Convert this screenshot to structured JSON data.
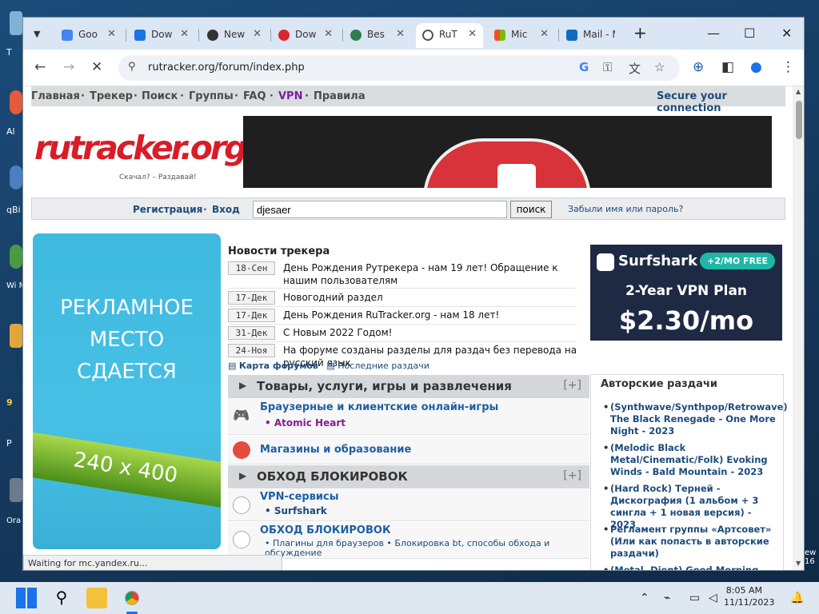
{
  "desktop": {
    "icons": [
      "T",
      "Al",
      "qBi",
      "Wi\nMed",
      "9",
      "P",
      "Ora\nVir",
      "ew\n16"
    ]
  },
  "browser": {
    "tabs": [
      {
        "title": "Goo",
        "icon": "google-icon",
        "color": "#4285f4"
      },
      {
        "title": "Dow",
        "icon": "download-icon",
        "color": "#1a73e8"
      },
      {
        "title": "New",
        "icon": "chrome-icon",
        "color": "#333333"
      },
      {
        "title": "Dow",
        "icon": "mega-icon",
        "color": "#d9272e"
      },
      {
        "title": "Bes",
        "icon": "app-icon",
        "color": "#2e7d4f"
      },
      {
        "title": "RuT",
        "icon": "loading-icon",
        "color": "#555555",
        "active": true
      },
      {
        "title": "Mic",
        "icon": "microsoft-icon",
        "color": "#f25022"
      },
      {
        "title": "Mail - M",
        "icon": "outlook-icon",
        "color": "#0f6cbd"
      }
    ],
    "url": "rutracker.org/forum/index.php",
    "status": "Waiting for mc.yandex.ru..."
  },
  "site": {
    "nav": [
      "Главная",
      "Трекер",
      "Поиск",
      "Группы",
      "FAQ",
      "VPN",
      "Правила"
    ],
    "nav_sep": "·",
    "secure": "Secure your connection",
    "logo": "rutracker",
    "logo_org": ".org",
    "tagline": "Скачал? – Раздавай!",
    "register": "Регистрация",
    "login": "Вход",
    "search_value": "djesaer",
    "search_button": "поиск",
    "forgot": "Забыли имя или пароль?",
    "ad_left": {
      "lines": [
        "РЕКЛАМНОЕ",
        "МЕСТО",
        "СДАЕТСЯ"
      ],
      "size": "240 x 400"
    },
    "news_title": "Новости трекера",
    "news": [
      {
        "date": "18-Сен",
        "text": "День Рождения Рутрекера - нам 19 лет! Обращение к нашим пользователям"
      },
      {
        "date": "17-Дек",
        "text": "Новогодний раздел"
      },
      {
        "date": "17-Дек",
        "text": "День Рождения RuTracker.org - нам 18 лет!"
      },
      {
        "date": "31-Дек",
        "text": "С Новым 2022 Годом!"
      },
      {
        "date": "24-Ноя",
        "text": "На форуме созданы разделы для раздач без перевода на русский язык"
      }
    ],
    "ad_right": {
      "brand": "Surfshark",
      "badge": "+2/MO FREE",
      "plan": "2-Year VPN Plan",
      "price": "$2.30/mo"
    },
    "forum_map": "Карта форумов",
    "last_torrents": "Последние раздачи",
    "categories": [
      {
        "title": "Товары, услуги, игры и развлечения",
        "plus": "[+]"
      },
      {
        "title": "ОБХОД БЛОКИРОВОК",
        "plus": "[+]"
      }
    ],
    "forums": [
      {
        "title": "Браузерные и клиентские онлайн-игры",
        "sub": "Atomic Heart"
      },
      {
        "title": "Магазины и образование"
      },
      {
        "title": "VPN-сервисы",
        "sub": "Surfshark"
      },
      {
        "title": "ОБХОД БЛОКИРОВОК",
        "sub": "Плагины для браузеров • Блокировка bt, способы обхода и обсуждение"
      }
    ],
    "sidebox_title": "Авторские раздачи",
    "sidebox_items": [
      "(Synthwave/Synthpop/Retrowave) The Black Renegade - One More Night - 2023",
      "(Melodic Black Metal/Cinematic/Folk) Evoking Winds - Bald Mountain - 2023",
      "(Hard Rock) Терней - Дискография (1 альбом + 3 сингла + 1 новая версия) - 2023",
      "Регламент группы «Артсовет» (Или как попасть в авторские раздачи)",
      "(Metal, Djent) Good Morning"
    ]
  },
  "taskbar": {
    "time": "8:05 AM",
    "date": "11/11/2023"
  }
}
